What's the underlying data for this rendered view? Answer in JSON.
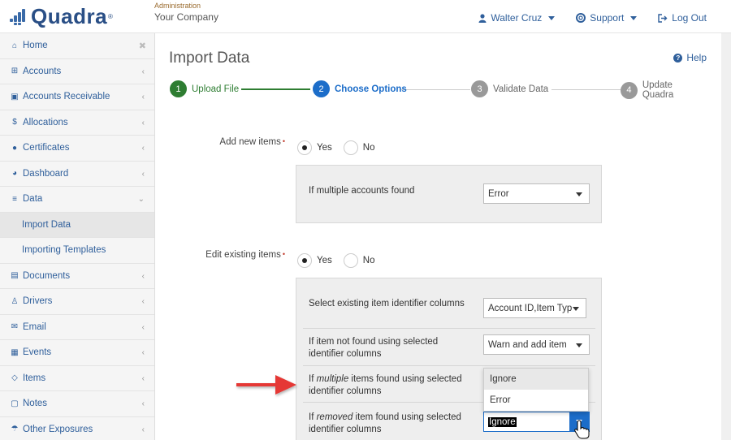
{
  "header": {
    "logo_text": "Quadra",
    "logo_mark": "®",
    "company_caption": "Administration",
    "company_name": "Your Company",
    "user": "Walter Cruz",
    "support": "Support",
    "logout": "Log Out",
    "accent": "#2f5f9b"
  },
  "sidebar": {
    "items": [
      {
        "label": "Home",
        "icon": "home-icon"
      },
      {
        "label": "Accounts",
        "icon": "sitemap-icon"
      },
      {
        "label": "Accounts Receivable",
        "icon": "money-icon"
      },
      {
        "label": "Allocations",
        "icon": "dollar-icon"
      },
      {
        "label": "Certificates",
        "icon": "certificate-icon"
      },
      {
        "label": "Dashboard",
        "icon": "dashboard-icon"
      },
      {
        "label": "Data",
        "icon": "database-icon"
      },
      {
        "label": "Import Data",
        "icon": ""
      },
      {
        "label": "Importing Templates",
        "icon": ""
      },
      {
        "label": "Documents",
        "icon": "document-icon"
      },
      {
        "label": "Drivers",
        "icon": "driver-icon"
      },
      {
        "label": "Email",
        "icon": "envelope-icon"
      },
      {
        "label": "Events",
        "icon": "calendar-icon"
      },
      {
        "label": "Items",
        "icon": "diamond-icon"
      },
      {
        "label": "Notes",
        "icon": "note-icon"
      },
      {
        "label": "Other Exposures",
        "icon": "umbrella-icon"
      }
    ]
  },
  "main": {
    "title": "Import Data",
    "help": "Help",
    "steps": [
      {
        "num": "1",
        "label": "Upload File",
        "state": "done",
        "color": "#2e7d32"
      },
      {
        "num": "2",
        "label": "Choose Options",
        "state": "active",
        "color": "#1c6dc9"
      },
      {
        "num": "3",
        "label": "Validate Data",
        "state": "pending",
        "color": "#999999"
      },
      {
        "num": "4",
        "label": "Update Quadra",
        "state": "pending",
        "color": "#999999"
      }
    ],
    "add_new": {
      "label": "Add new items",
      "yes": "Yes",
      "no": "No",
      "selected": "Yes",
      "multiple_accounts_label": "If multiple accounts found",
      "multiple_accounts_value": "Error"
    },
    "edit_existing": {
      "label": "Edit existing items",
      "yes": "Yes",
      "no": "No",
      "selected": "Yes",
      "identifier_label": "Select existing item identifier columns",
      "identifier_value": "Account ID,Item Type",
      "not_found_label_1": "If item not found using selected",
      "not_found_label_2": "identifier columns",
      "not_found_value": "Warn and add item",
      "multiple_label_pre": "If ",
      "multiple_label_em": "multiple",
      "multiple_label_post": " items found using selected",
      "multiple_label_2": "identifier columns",
      "multiple_options": [
        "Ignore",
        "Error"
      ],
      "removed_label_pre": "If ",
      "removed_label_em": "removed",
      "removed_label_post": " item found using selected",
      "removed_label_2": "identifier columns",
      "removed_value": "Ignore"
    }
  }
}
